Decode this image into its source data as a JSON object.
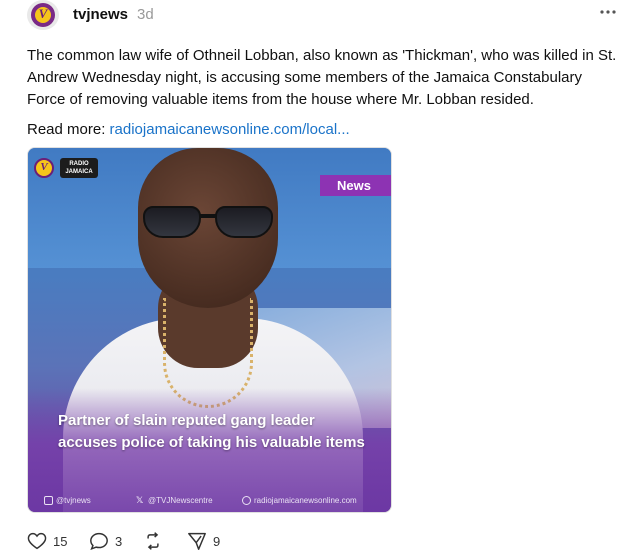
{
  "post": {
    "username": "tvjnews",
    "timestamp": "3d",
    "more_icon": "more-horizontal-icon",
    "text": "The common law wife of Othneil Lobban, also known as 'Thickman', who was killed in St. Andrew Wednesday night, is accusing some members of the Jamaica Constabulary Force of removing valuable items from the house where Mr. Lobban resided.",
    "read_more_label": "Read more:",
    "read_more_link": "radiojamaicanewsonline.com/local..."
  },
  "media": {
    "logo_letter": "V",
    "radio_badge": "RADIO\nJAMAICA",
    "news_tag": "News",
    "caption": "Partner of slain reputed gang leader accuses police of taking his valuable items",
    "footer": {
      "instagram": "@tvjnews",
      "x": "@TVJNewscentre",
      "web": "radiojamaicanewsonline.com"
    }
  },
  "actions": {
    "likes": "15",
    "comments": "3",
    "reposts": "",
    "shares": "9"
  },
  "colors": {
    "accent_link": "#1a73c9",
    "news_tag": "#8d33b3",
    "brand_yellow": "#f6c51b",
    "brand_purple": "#6a1f78"
  }
}
